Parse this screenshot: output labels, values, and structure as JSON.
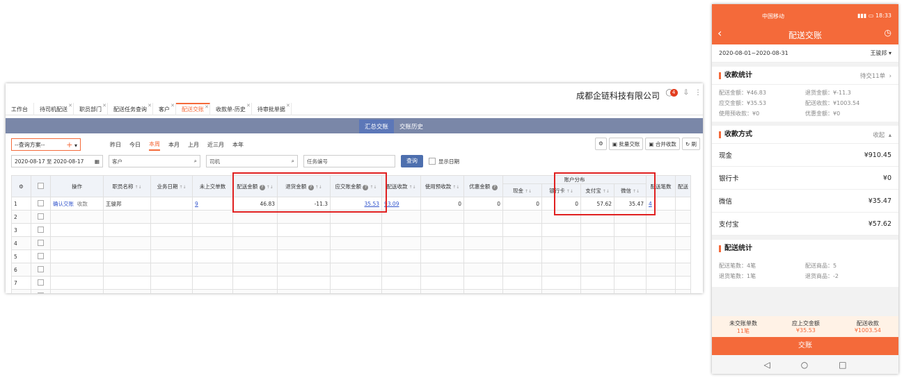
{
  "desktop": {
    "company": "成都企链科技有限公司",
    "notify_count": "4",
    "tabs": [
      {
        "label": "工作台",
        "closable": false
      },
      {
        "label": "待司机配送",
        "closable": true
      },
      {
        "label": "职员部门",
        "closable": true
      },
      {
        "label": "配送任务查询",
        "closable": true
      },
      {
        "label": "客户",
        "closable": true
      },
      {
        "label": "配送交账",
        "closable": true,
        "active": true
      },
      {
        "label": "收款单-历史",
        "closable": true
      },
      {
        "label": "待审批单据",
        "closable": true
      }
    ],
    "sub_tabs": [
      "汇总交账",
      "交账历史"
    ],
    "scheme_label": "--查询方案--",
    "periods": [
      "昨日",
      "今日",
      "本周",
      "本月",
      "上月",
      "近三月",
      "本年"
    ],
    "buttons": {
      "batch": "批量交账",
      "merge": "合并收款",
      "refresh": "刷"
    },
    "date_range": "2020-08-17 至 2020-08-17",
    "placeholders": {
      "customer": "客户",
      "driver": "司机",
      "task": "任务编号"
    },
    "query_label": "查询",
    "show_date_label": "显示日期",
    "table": {
      "group_header": "账户分布",
      "columns": [
        "",
        "",
        "操作",
        "职员名称",
        "业务日期",
        "未上交单数",
        "配送金额",
        "退货金额",
        "应交账金额",
        "配送收款",
        "使用预收款",
        "优惠金额",
        "现金",
        "银行卡",
        "支付宝",
        "微信",
        "配送笔数",
        "配送"
      ],
      "row": {
        "index": "1",
        "action1": "确认交账",
        "action2": "收款",
        "staff": "王骏邦",
        "date": "",
        "pending": "9",
        "delivery_amt": "46.83",
        "return_amt": "-11.3",
        "due_amt": "35.53",
        "collected": "93.09",
        "prepaid": "0",
        "discount": "0",
        "cash": "0",
        "bank": "0",
        "alipay": "57.62",
        "wechat": "35.47",
        "count": "4"
      },
      "empty_rows": [
        "2",
        "3",
        "4",
        "5",
        "6",
        "7",
        ""
      ]
    }
  },
  "mobile": {
    "carrier": "中国移动",
    "clock": "18:33",
    "title": "配送交账",
    "date_range": "2020-08-01~2020-08-31",
    "user": "王骏邦",
    "stats_title": "收款统计",
    "stats_right": "待交11单",
    "stats": [
      "配送金额：¥46.83",
      "退货金额：¥-11.3",
      "应交金额：¥35.53",
      "配送收款：¥1003.54",
      "使用预收款：¥0",
      "优惠金额：¥0"
    ],
    "pay_title": "收款方式",
    "pay_collapse": "收起",
    "payments": [
      {
        "name": "现金",
        "value": "¥910.45"
      },
      {
        "name": "银行卡",
        "value": "¥0"
      },
      {
        "name": "微信",
        "value": "¥35.47"
      },
      {
        "name": "支付宝",
        "value": "¥57.62"
      }
    ],
    "delivery_title": "配送统计",
    "delivery_stats": [
      "配送笔数：4笔",
      "配送商品：5",
      "退货笔数：1笔",
      "退货商品：-2"
    ],
    "footer": [
      {
        "label": "未交账单数",
        "value": "11笔"
      },
      {
        "label": "应上交金额",
        "value": "¥35.53"
      },
      {
        "label": "配送收款",
        "value": "¥1003.54"
      }
    ],
    "submit_label": "交账"
  }
}
